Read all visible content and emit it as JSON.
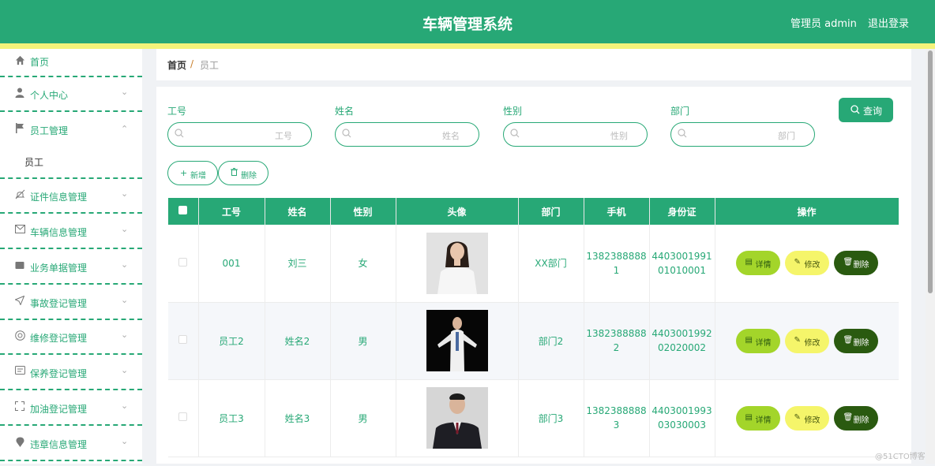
{
  "header": {
    "title": "车辆管理系统",
    "user": "管理员 admin",
    "logout": "退出登录"
  },
  "sidebar": {
    "items": [
      {
        "label": "首页",
        "icon": "home-icon"
      },
      {
        "label": "个人中心",
        "icon": "user-icon"
      },
      {
        "label": "员工管理",
        "icon": "flag-icon",
        "expanded": true
      },
      {
        "label": "证件信息管理",
        "icon": "bell-off-icon"
      },
      {
        "label": "车辆信息管理",
        "icon": "mail-icon"
      },
      {
        "label": "业务单据管理",
        "icon": "box-icon"
      },
      {
        "label": "事故登记管理",
        "icon": "send-icon"
      },
      {
        "label": "维修登记管理",
        "icon": "help-circle-icon"
      },
      {
        "label": "保养登记管理",
        "icon": "message-icon"
      },
      {
        "label": "加油登记管理",
        "icon": "fullscreen-icon"
      },
      {
        "label": "违章信息管理",
        "icon": "location-icon"
      }
    ],
    "submenu": {
      "label": "员工"
    }
  },
  "breadcrumb": {
    "home": "首页",
    "separator": "/",
    "current": "员工"
  },
  "search": {
    "fields": [
      {
        "label": "工号",
        "placeholder": "工号"
      },
      {
        "label": "姓名",
        "placeholder": "姓名"
      },
      {
        "label": "性别",
        "placeholder": "性别"
      },
      {
        "label": "部门",
        "placeholder": "部门"
      }
    ],
    "query_label": "查询"
  },
  "actions": {
    "add_label": "新增",
    "delete_label": "删除"
  },
  "table": {
    "columns": [
      "工号",
      "姓名",
      "性别",
      "头像",
      "部门",
      "手机",
      "身份证",
      "操作"
    ],
    "rows": [
      {
        "id": "001",
        "name": "刘三",
        "gender": "女",
        "dept": "XX部门",
        "phone_1": "1382388888",
        "phone_2": "1",
        "idcard_1": "4403001991",
        "idcard_2": "01010001"
      },
      {
        "id": "员工2",
        "name": "姓名2",
        "gender": "男",
        "dept": "部门2",
        "phone_1": "1382388888",
        "phone_2": "2",
        "idcard_1": "4403001992",
        "idcard_2": "02020002"
      },
      {
        "id": "员工3",
        "name": "姓名3",
        "gender": "男",
        "dept": "部门3",
        "phone_1": "1382388888",
        "phone_2": "3",
        "idcard_1": "4403001993",
        "idcard_2": "03030003"
      }
    ],
    "ops": {
      "detail": "详情",
      "edit": "修改",
      "delete": "删除"
    }
  },
  "watermark": "@51CTO博客",
  "colors": {
    "primary": "#27a876",
    "stripe": "#f3f37a",
    "detail": "#a3d52a",
    "edit": "#f5f56a",
    "delete": "#2a5a10"
  }
}
